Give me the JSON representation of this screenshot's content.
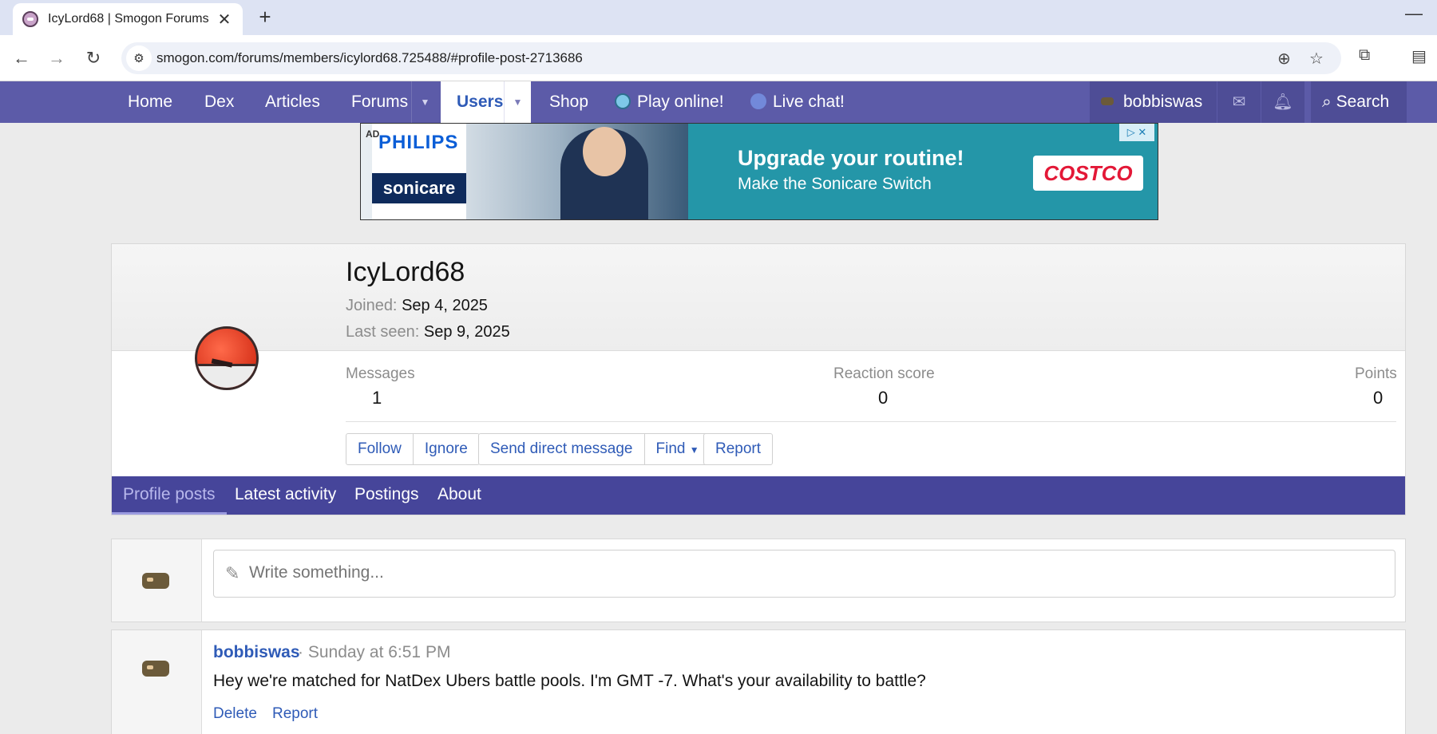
{
  "browser": {
    "tab_title": "IcyLord68 | Smogon Forums",
    "url": "smogon.com/forums/members/icylord68.725488/#profile-post-2713686"
  },
  "nav": {
    "home": "Home",
    "dex": "Dex",
    "articles": "Articles",
    "forums": "Forums",
    "users": "Users",
    "shop": "Shop",
    "play": "Play online!",
    "chat": "Live chat!",
    "account": "bobbiswas",
    "search": "Search"
  },
  "ad": {
    "tag": "AD",
    "brand": "PHILIPS",
    "product": "sonicare",
    "headline": "Upgrade your routine!",
    "sub": "Make the Sonicare Switch",
    "advertiser": "COSTCO"
  },
  "profile": {
    "username": "IcyLord68",
    "joined_label": "Joined:",
    "joined": "Sep 4, 2025",
    "seen_label": "Last seen:",
    "seen": "Sep 9, 2025",
    "stats": [
      {
        "label": "Messages",
        "value": "1"
      },
      {
        "label": "Reaction score",
        "value": "0"
      },
      {
        "label": "Points",
        "value": "0"
      }
    ],
    "buttons": {
      "follow": "Follow",
      "ignore": "Ignore",
      "dm": "Send direct message",
      "find": "Find",
      "report": "Report"
    },
    "tabs": [
      "Profile posts",
      "Latest activity",
      "Postings",
      "About"
    ]
  },
  "composer": {
    "placeholder": "Write something..."
  },
  "post": {
    "author": "bobbiswas",
    "time": "· Sunday at 6:51 PM",
    "body": "Hey we're matched for NatDex Ubers battle pools. I'm GMT -7. What's your availability to battle?",
    "delete": "Delete",
    "report": "Report"
  },
  "colors": {
    "nav_bg": "#5c5ba8",
    "tabs_bg": "#46459a",
    "link": "#2f5bb7"
  }
}
